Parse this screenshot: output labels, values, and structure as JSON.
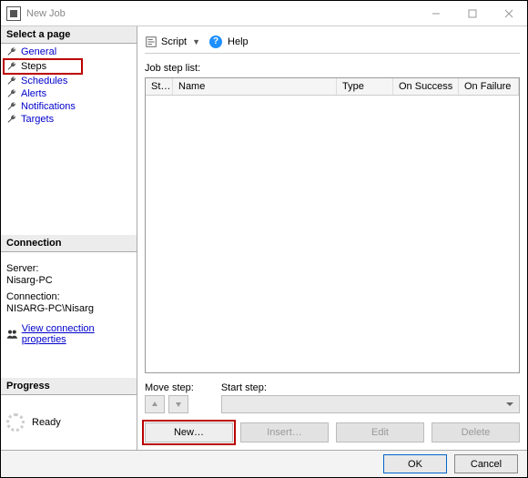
{
  "window": {
    "title": "New Job"
  },
  "select_page": {
    "header": "Select a page",
    "items": [
      {
        "label": "General"
      },
      {
        "label": "Steps"
      },
      {
        "label": "Schedules"
      },
      {
        "label": "Alerts"
      },
      {
        "label": "Notifications"
      },
      {
        "label": "Targets"
      }
    ]
  },
  "connection": {
    "header": "Connection",
    "server_label": "Server:",
    "server_value": "Nisarg-PC",
    "conn_label": "Connection:",
    "conn_value": "NISARG-PC\\Nisarg",
    "link": "View connection properties"
  },
  "progress": {
    "header": "Progress",
    "status": "Ready"
  },
  "toolbar": {
    "script": "Script",
    "help": "Help"
  },
  "step_list": {
    "label": "Job step list:",
    "columns": {
      "st": "St…",
      "name": "Name",
      "type": "Type",
      "success": "On Success",
      "failure": "On Failure"
    }
  },
  "move": {
    "label": "Move step:",
    "start_label": "Start step:"
  },
  "actions": {
    "new": "New…",
    "insert": "Insert…",
    "edit": "Edit",
    "delete": "Delete"
  },
  "footer": {
    "ok": "OK",
    "cancel": "Cancel"
  }
}
